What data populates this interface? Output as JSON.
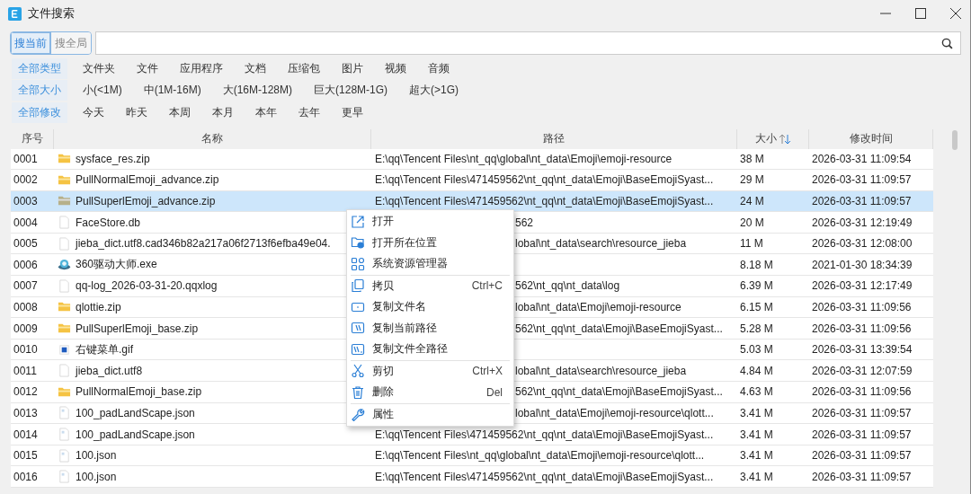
{
  "window": {
    "title": "文件搜索"
  },
  "scope": [
    {
      "label": "搜当前",
      "selected": true
    },
    {
      "label": "搜全局",
      "selected": false
    }
  ],
  "filters": [
    {
      "items": [
        {
          "label": "全部类型",
          "selected": true
        },
        {
          "label": "文件夹",
          "selected": false
        },
        {
          "label": "文件",
          "selected": false
        },
        {
          "label": "应用程序",
          "selected": false
        },
        {
          "label": "文档",
          "selected": false
        },
        {
          "label": "压缩包",
          "selected": false
        },
        {
          "label": "图片",
          "selected": false
        },
        {
          "label": "视频",
          "selected": false
        },
        {
          "label": "音频",
          "selected": false
        }
      ]
    },
    {
      "items": [
        {
          "label": "全部大小",
          "selected": true
        },
        {
          "label": "小(<1M)",
          "selected": false
        },
        {
          "label": "中(1M-16M)",
          "selected": false
        },
        {
          "label": "大(16M-128M)",
          "selected": false
        },
        {
          "label": "巨大(128M-1G)",
          "selected": false
        },
        {
          "label": "超大(>1G)",
          "selected": false
        }
      ]
    },
    {
      "items": [
        {
          "label": "全部修改",
          "selected": true
        },
        {
          "label": "今天",
          "selected": false
        },
        {
          "label": "昨天",
          "selected": false
        },
        {
          "label": "本周",
          "selected": false
        },
        {
          "label": "本月",
          "selected": false
        },
        {
          "label": "本年",
          "selected": false
        },
        {
          "label": "去年",
          "selected": false
        },
        {
          "label": "更早",
          "selected": false
        }
      ]
    }
  ],
  "table": {
    "columns": [
      {
        "label": "序号",
        "sorted": false
      },
      {
        "label": "名称",
        "sorted": false
      },
      {
        "label": "路径",
        "sorted": false
      },
      {
        "label": "大小",
        "sorted": true
      },
      {
        "label": "修改时间",
        "sorted": false
      }
    ],
    "rows": [
      {
        "index": "0001",
        "kind": "zip",
        "name": "sysface_res.zip",
        "path": "E:\\qq\\Tencent Files\\nt_qq\\global\\nt_data\\Emoji\\emoji-resource",
        "behind_menu": false,
        "size": "38 M",
        "modified": "2026-03-31 11:09:54",
        "selected": false
      },
      {
        "index": "0002",
        "kind": "zip",
        "name": "PullNormalEmoji_advance.zip",
        "path": "E:\\qq\\Tencent Files\\471459562\\nt_qq\\nt_data\\Emoji\\BaseEmojiSyast...",
        "behind_menu": false,
        "size": "29 M",
        "modified": "2026-03-31 11:09:57",
        "selected": false
      },
      {
        "index": "0003",
        "kind": "zip",
        "name": "PullSuperlEmoji_advance.zip",
        "path": "E:\\qq\\Tencent Files\\471459562\\nt_qq\\nt_data\\Emoji\\BaseEmojiSyast...",
        "behind_menu": false,
        "size": "24 M",
        "modified": "2026-03-31 11:09:57",
        "selected": true
      },
      {
        "index": "0004",
        "kind": "file",
        "name": "FaceStore.db",
        "path": "562",
        "behind_menu": true,
        "size": "20 M",
        "modified": "2026-03-31 12:19:49",
        "selected": false
      },
      {
        "index": "0005",
        "kind": "file",
        "name": "jieba_dict.utf8.cad346b82a217a06f2713f6efba49e04.",
        "path": "lobal\\nt_data\\search\\resource_jieba",
        "behind_menu": true,
        "size": "11 M",
        "modified": "2026-03-31 12:08:00",
        "selected": false
      },
      {
        "index": "0006",
        "kind": "exe",
        "name": "360驱动大师.exe",
        "size": "8.18 M",
        "modified": "2021-01-30 18:34:39",
        "selected": false
      },
      {
        "index": "0007",
        "kind": "file",
        "name": "qq-log_2026-03-31-20.qqxlog",
        "path": "562\\nt_qq\\nt_data\\log",
        "behind_menu": true,
        "size": "6.39 M",
        "modified": "2026-03-31 12:17:49",
        "selected": false
      },
      {
        "index": "0008",
        "kind": "zip",
        "name": "qlottie.zip",
        "path": "lobal\\nt_data\\Emoji\\emoji-resource",
        "behind_menu": true,
        "size": "6.15 M",
        "modified": "2026-03-31 11:09:56",
        "selected": false
      },
      {
        "index": "0009",
        "kind": "zip",
        "name": "PullSuperlEmoji_base.zip",
        "path": "562\\nt_qq\\nt_data\\Emoji\\BaseEmojiSyast...",
        "behind_menu": true,
        "size": "5.28 M",
        "modified": "2026-03-31 11:09:56",
        "selected": false
      },
      {
        "index": "0010",
        "kind": "image",
        "name": "右键菜单.gif",
        "size": "5.03 M",
        "modified": "2026-03-31 13:39:54",
        "selected": false
      },
      {
        "index": "0011",
        "kind": "file",
        "name": "jieba_dict.utf8",
        "path": "lobal\\nt_data\\search\\resource_jieba",
        "behind_menu": true,
        "size": "4.84 M",
        "modified": "2026-03-31 12:07:59",
        "selected": false
      },
      {
        "index": "0012",
        "kind": "zip",
        "name": "PullNormalEmoji_base.zip",
        "path": "562\\nt_qq\\nt_data\\Emoji\\BaseEmojiSyast...",
        "behind_menu": true,
        "size": "4.63 M",
        "modified": "2026-03-31 11:09:56",
        "selected": false
      },
      {
        "index": "0013",
        "kind": "json",
        "name": "100_padLandScape.json",
        "path": "lobal\\nt_data\\Emoji\\emoji-resource\\qlott...",
        "behind_menu": true,
        "size": "3.41 M",
        "modified": "2026-03-31 11:09:57",
        "selected": false
      },
      {
        "index": "0014",
        "kind": "json",
        "name": "100_padLandScape.json",
        "path": "E:\\qq\\Tencent Files\\471459562\\nt_qq\\nt_data\\Emoji\\BaseEmojiSyast...",
        "behind_menu": false,
        "size": "3.41 M",
        "modified": "2026-03-31 11:09:57",
        "selected": false
      },
      {
        "index": "0015",
        "kind": "json",
        "name": "100.json",
        "path": "E:\\qq\\Tencent Files\\nt_qq\\global\\nt_data\\Emoji\\emoji-resource\\qlott...",
        "behind_menu": false,
        "size": "3.41 M",
        "modified": "2026-03-31 11:09:57",
        "selected": false
      },
      {
        "index": "0016",
        "kind": "json",
        "name": "100.json",
        "path": "E:\\qq\\Tencent Files\\471459562\\nt_qq\\nt_data\\Emoji\\BaseEmojiSyast...",
        "behind_menu": false,
        "size": "3.41 M",
        "modified": "2026-03-31 11:09:57",
        "selected": false
      }
    ]
  },
  "context_menu": {
    "items": [
      {
        "label": "打开",
        "separator_before": false
      },
      {
        "label": "打开所在位置",
        "separator_before": false
      },
      {
        "label": "系统资源管理器",
        "separator_before": false
      },
      {
        "label": "拷贝",
        "shortcut": "Ctrl+C",
        "separator_before": true
      },
      {
        "label": "复制文件名",
        "separator_before": false
      },
      {
        "label": "复制当前路径",
        "separator_before": false
      },
      {
        "label": "复制文件全路径",
        "separator_before": false
      },
      {
        "label": "剪切",
        "shortcut": "Ctrl+X",
        "separator_before": true
      },
      {
        "label": "删除",
        "shortcut": "Del",
        "separator_before": false
      },
      {
        "label": "属性",
        "separator_before": true
      }
    ]
  }
}
